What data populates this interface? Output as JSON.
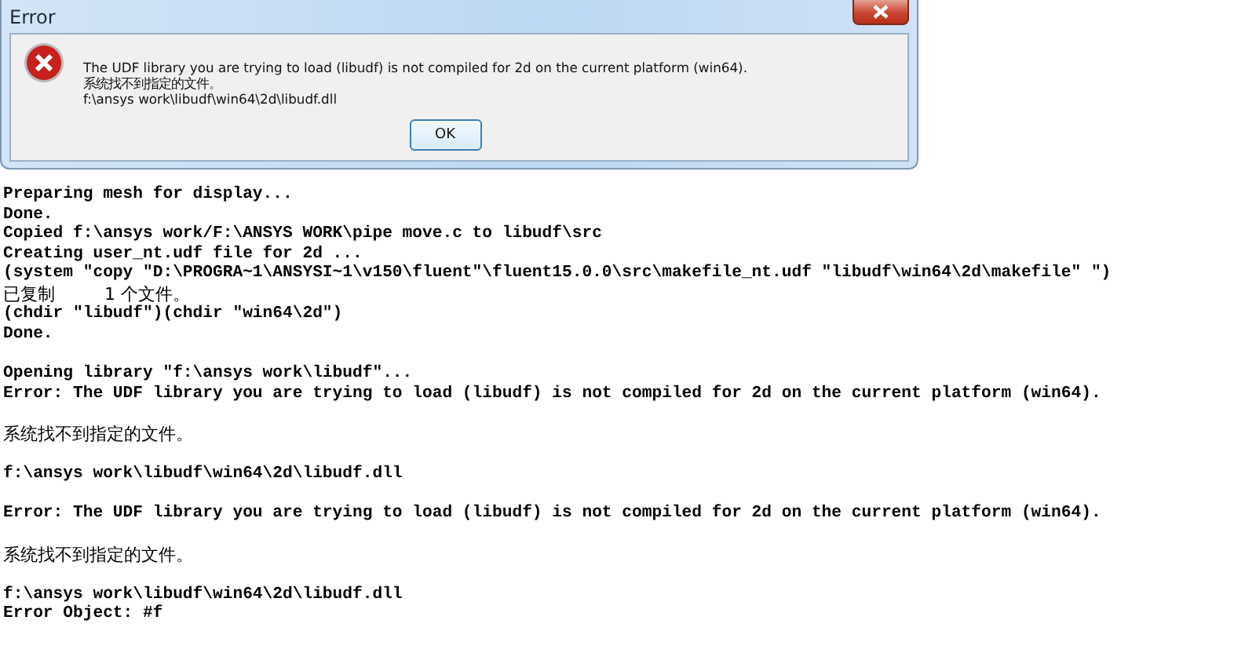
{
  "dialog": {
    "title": "Error",
    "message": [
      "The UDF library you are trying to load (libudf) is not compiled for 2d on the current platform (win64).",
      "系统找不到指定的文件。",
      "f:\\ansys work\\libudf\\win64\\2d\\libudf.dll"
    ],
    "buttons": [
      "OK"
    ]
  },
  "console": [
    {
      "kind": "text",
      "text": "Preparing mesh for display..."
    },
    {
      "kind": "text",
      "text": "Done."
    },
    {
      "kind": "text",
      "text": "Copied f:\\ansys work/F:\\ANSYS WORK\\pipe move.c to libudf\\src"
    },
    {
      "kind": "text",
      "text": "Creating user_nt.udf file for 2d ..."
    },
    {
      "kind": "text",
      "text": "(system \"copy \"D:\\PROGRA~1\\ANSYSI~1\\v150\\fluent\"\\fluent15.0.0\\src\\makefile_nt.udf \"libudf\\win64\\2d\\makefile\" \")"
    },
    {
      "kind": "cjk",
      "text": "已复制         1 个文件。"
    },
    {
      "kind": "text",
      "text": "(chdir \"libudf\")(chdir \"win64\\2d\")"
    },
    {
      "kind": "text",
      "text": "Done."
    },
    {
      "kind": "blank"
    },
    {
      "kind": "text",
      "text": "Opening library \"f:\\ansys work\\libudf\"..."
    },
    {
      "kind": "text",
      "text": "Error: The UDF library you are trying to load (libudf) is not compiled for 2d on the current platform (win64)."
    },
    {
      "kind": "blank"
    },
    {
      "kind": "cjk",
      "text": "系统找不到指定的文件。"
    },
    {
      "kind": "blank"
    },
    {
      "kind": "text",
      "text": "f:\\ansys work\\libudf\\win64\\2d\\libudf.dll"
    },
    {
      "kind": "blank"
    },
    {
      "kind": "text",
      "text": "Error: The UDF library you are trying to load (libudf) is not compiled for 2d on the current platform (win64)."
    },
    {
      "kind": "blank"
    },
    {
      "kind": "cjk",
      "text": "系统找不到指定的文件。"
    },
    {
      "kind": "blank"
    },
    {
      "kind": "text",
      "text": "f:\\ansys work\\libudf\\win64\\2d\\libudf.dll"
    },
    {
      "kind": "text",
      "text": "Error Object: #f"
    }
  ]
}
